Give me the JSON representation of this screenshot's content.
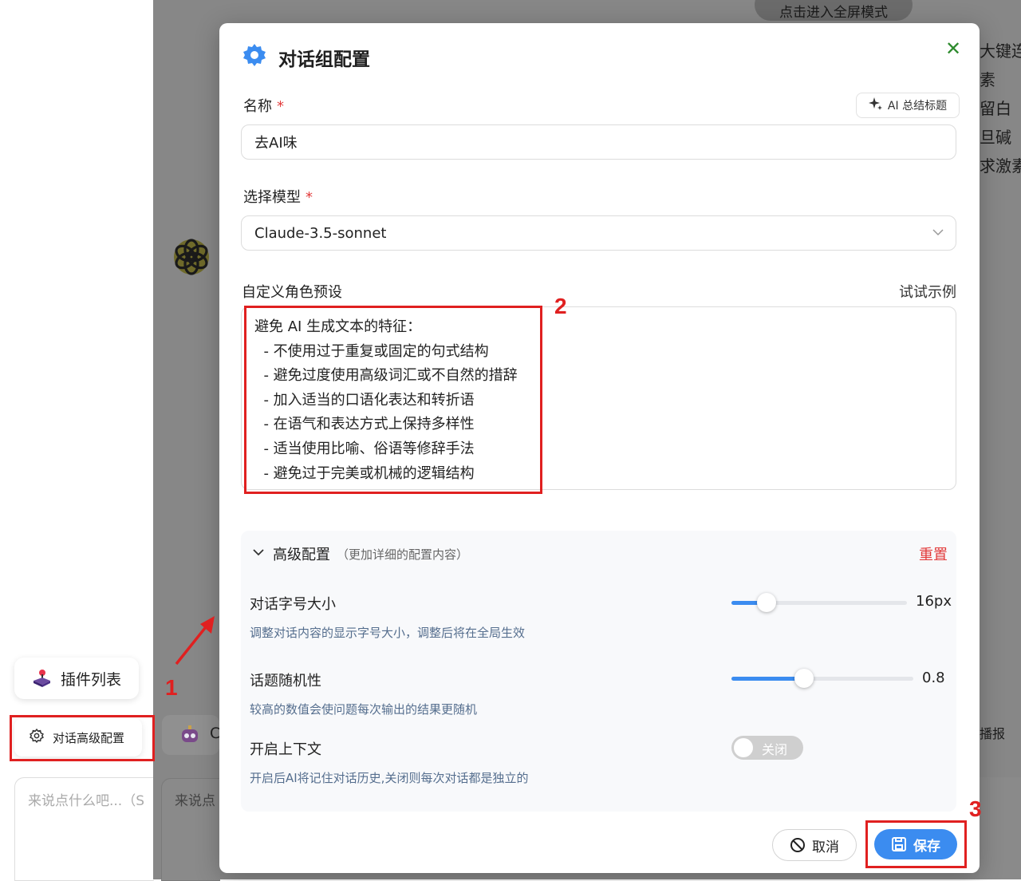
{
  "app": {
    "fullscreen_hint": "点击进入全屏模式",
    "plugin_list_label": "插件列表",
    "advanced_config_label": "对话高级配置",
    "left_input_placeholder": "来说点什么吧...（S",
    "second_input_placeholder": "来说点",
    "bot_card_letter": "C",
    "right_items": [
      "大键连接",
      "素",
      "留白",
      "旦碱",
      "求激素"
    ],
    "right_broadcast": "播报"
  },
  "modal": {
    "title": "对话组配置",
    "close_icon": "close-icon",
    "name_label": "名称",
    "required_mark": "*",
    "ai_title_button": "AI 总结标题",
    "name_value": "去AI味",
    "model_label": "选择模型",
    "model_value": "Claude-3.5-sonnet",
    "preset_label": "自定义角色预设",
    "try_example": "试试示例",
    "preset_lines": [
      "避免 AI 生成文本的特征：",
      "  - 不使用过于重复或固定的句式结构",
      "  - 避免过度使用高级词汇或不自然的措辞",
      "  - 加入适当的口语化表达和转折语",
      "  - 在语气和表达方式上保持多样性",
      "  - 适当使用比喻、俗语等修辞手法",
      "  - 避免过于完美或机械的逻辑结构"
    ],
    "advanced": {
      "title": "高级配置",
      "subtitle": "（更加详细的配置内容）",
      "reset": "重置",
      "font_size_label": "对话字号大小",
      "font_size_desc": "调整对话内容的显示字号大小，调整后将在全局生效",
      "font_size_value": "16px",
      "font_size_fraction": 0.2,
      "randomness_label": "话题随机性",
      "randomness_desc": "较高的数值会使问题每次输出的结果更随机",
      "randomness_value": "0.8",
      "randomness_fraction": 0.4,
      "context_label": "开启上下文",
      "context_desc": "开启后AI将记住对话历史,关闭则每次对话都是独立的",
      "context_toggle": "关闭"
    },
    "cancel_label": "取消",
    "save_label": "保存"
  },
  "annotations": [
    "1",
    "2",
    "3"
  ],
  "colors": {
    "accent": "#3b8cf0",
    "danger": "#e23b3b",
    "annotation": "#e02020"
  }
}
